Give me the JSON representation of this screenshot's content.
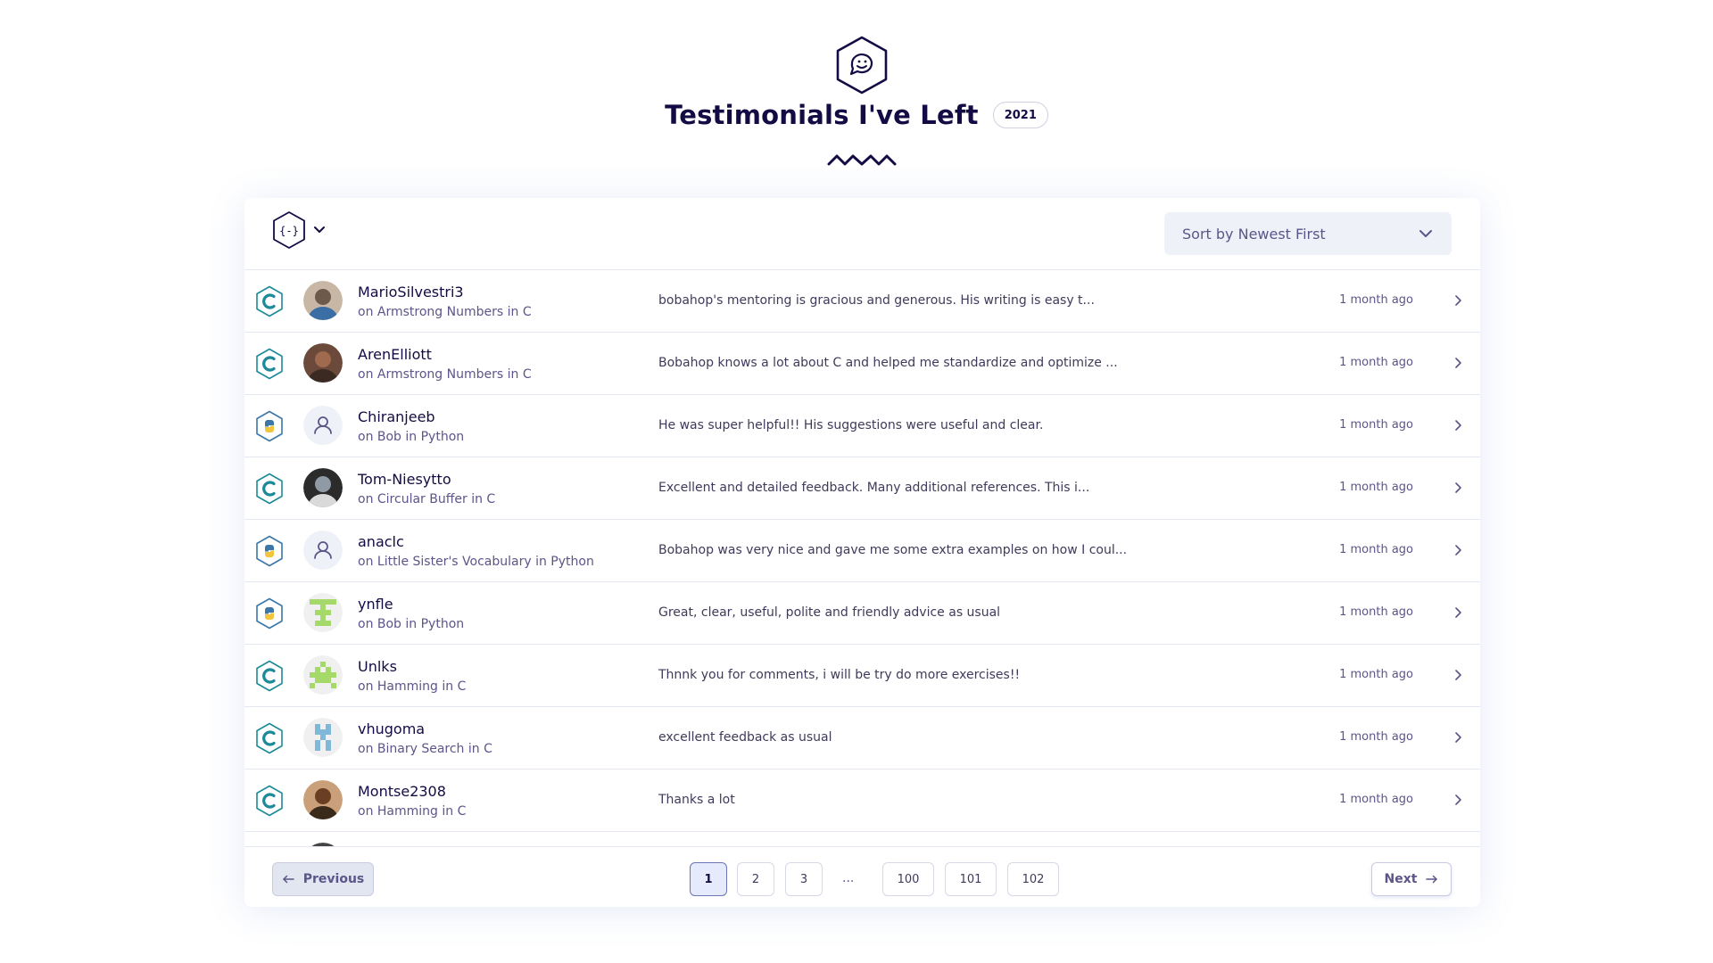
{
  "header": {
    "icon": "speech-bubble-hexagon-icon",
    "title": "Testimonials I've Left",
    "year": "2021"
  },
  "toolbar": {
    "track_filter_icon": "curly-braces-hexagon-icon",
    "sort_label": "Sort by Newest First"
  },
  "testimonials": [
    {
      "track": "C",
      "track_icon": "c-track-icon",
      "avatar": "photo",
      "name": "MarioSilvestri3",
      "exercise": "on Armstrong Numbers in C",
      "content": "bobahop's mentoring is gracious and generous. His writing is easy t...",
      "time": "1 month ago"
    },
    {
      "track": "C",
      "track_icon": "c-track-icon",
      "avatar": "photo",
      "name": "ArenElliott",
      "exercise": "on Armstrong Numbers in C",
      "content": "Bobahop knows a lot about C and helped me standardize and optimize ...",
      "time": "1 month ago"
    },
    {
      "track": "Python",
      "track_icon": "python-track-icon",
      "avatar": "placeholder",
      "name": "Chiranjeeb",
      "exercise": "on Bob in Python",
      "content": "He was super helpful!! His suggestions were useful and clear.",
      "time": "1 month ago"
    },
    {
      "track": "C",
      "track_icon": "c-track-icon",
      "avatar": "photo",
      "name": "Tom-Niesytto",
      "exercise": "on Circular Buffer in C",
      "content": "Excellent and detailed feedback. Many additional references. This i...",
      "time": "1 month ago"
    },
    {
      "track": "Python",
      "track_icon": "python-track-icon",
      "avatar": "placeholder",
      "name": "anaclc",
      "exercise": "on Little Sister's Vocabulary in Python",
      "content": "Bobahop was very nice and gave me some extra examples on how I coul...",
      "time": "1 month ago"
    },
    {
      "track": "Python",
      "track_icon": "python-track-icon",
      "avatar": "identicon",
      "name": "ynfle",
      "exercise": "on Bob in Python",
      "content": "Great, clear, useful, polite and friendly advice as usual",
      "time": "1 month ago"
    },
    {
      "track": "C",
      "track_icon": "c-track-icon",
      "avatar": "identicon",
      "name": "Unlks",
      "exercise": "on Hamming in C",
      "content": "Thnnk you for comments, i will be try do more exercises!!",
      "time": "1 month ago"
    },
    {
      "track": "C",
      "track_icon": "c-track-icon",
      "avatar": "identicon",
      "name": "vhugoma",
      "exercise": "on Binary Search in C",
      "content": "excellent feedback as usual",
      "time": "1 month ago"
    },
    {
      "track": "C",
      "track_icon": "c-track-icon",
      "avatar": "photo",
      "name": "Montse2308",
      "exercise": "on Hamming in C",
      "content": "Thanks a lot",
      "time": "1 month ago"
    },
    {
      "track": "C",
      "track_icon": "c-track-icon",
      "avatar": "photo",
      "name": "",
      "exercise": "",
      "content": "",
      "time": ""
    }
  ],
  "pagination": {
    "previous_label": "Previous",
    "next_label": "Next",
    "pages": [
      "1",
      "2",
      "3",
      "100",
      "101",
      "102"
    ],
    "ellipsis": "...",
    "current": "1"
  },
  "colors": {
    "text_primary": "#130b43",
    "text_secondary": "#5c5589",
    "c_track": "#1c8a99",
    "python_track": "#3b77a8",
    "active_page_bg": "#e5ebfc"
  }
}
